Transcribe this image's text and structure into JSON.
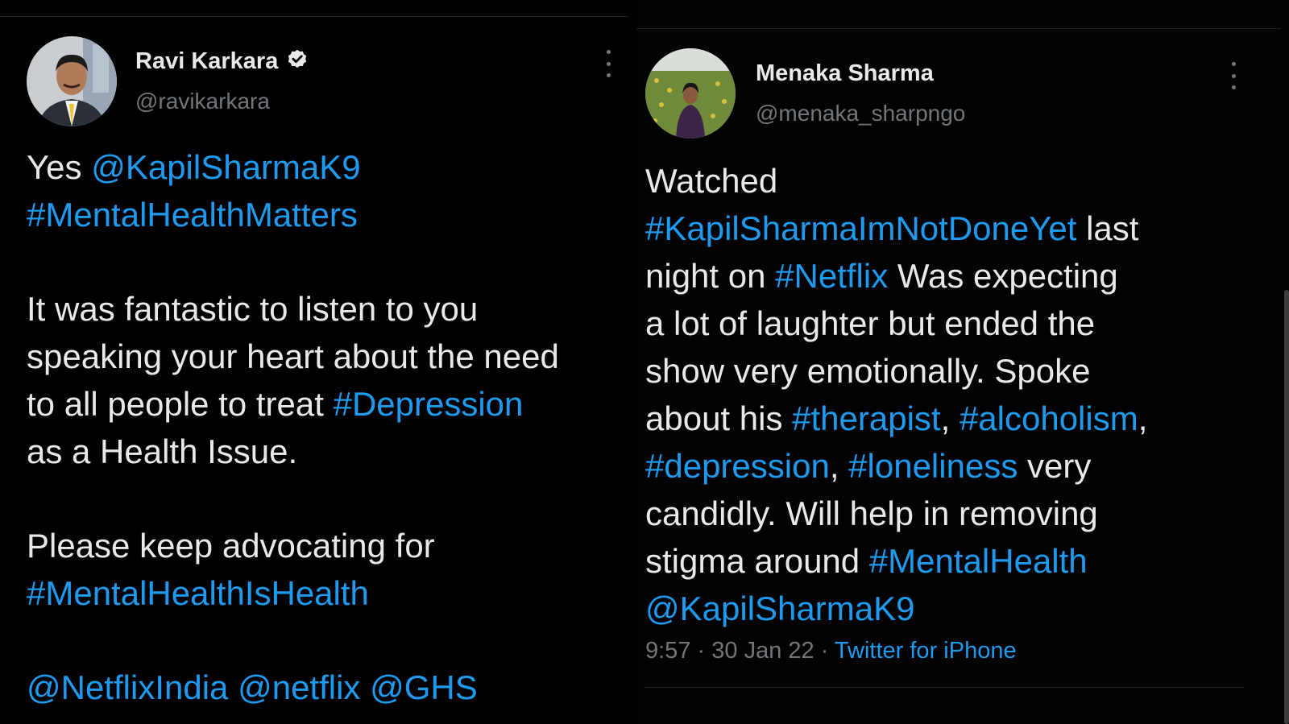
{
  "tweet_left": {
    "name": "Ravi Karkara",
    "verified": true,
    "handle": "@ravikarkara",
    "lines": [
      [
        {
          "t": "Yes "
        },
        {
          "t": "@KapilSharmaK9",
          "link": true
        }
      ],
      [
        {
          "t": "#MentalHealthMatters",
          "link": true
        }
      ],
      [],
      [
        {
          "t": "It was fantastic to listen to you"
        }
      ],
      [
        {
          "t": "speaking your heart about the need"
        }
      ],
      [
        {
          "t": "to all people to treat "
        },
        {
          "t": "#Depression",
          "link": true
        }
      ],
      [
        {
          "t": "as a Health Issue."
        }
      ],
      [],
      [
        {
          "t": "Please keep advocating for"
        }
      ],
      [
        {
          "t": "#MentalHealthIsHealth",
          "link": true
        }
      ],
      [],
      [
        {
          "t": "@NetflixIndia",
          "link": true
        },
        {
          "t": " "
        },
        {
          "t": "@netflix",
          "link": true
        },
        {
          "t": " "
        },
        {
          "t": "@GHS",
          "link": true
        }
      ]
    ]
  },
  "tweet_right": {
    "name": "Menaka Sharma",
    "verified": false,
    "handle": "@menaka_sharpngo",
    "lines": [
      [
        {
          "t": "Watched"
        }
      ],
      [
        {
          "t": "#KapilSharmaImNotDoneYet",
          "link": true
        },
        {
          "t": " last"
        }
      ],
      [
        {
          "t": "night on "
        },
        {
          "t": "#Netflix",
          "link": true
        },
        {
          "t": " Was expecting"
        }
      ],
      [
        {
          "t": "a lot of laughter but ended the"
        }
      ],
      [
        {
          "t": "show very emotionally. Spoke"
        }
      ],
      [
        {
          "t": "about his "
        },
        {
          "t": "#therapist",
          "link": true
        },
        {
          "t": ", "
        },
        {
          "t": "#alcoholism",
          "link": true
        },
        {
          "t": ","
        }
      ],
      [
        {
          "t": "#depression",
          "link": true
        },
        {
          "t": ", "
        },
        {
          "t": "#loneliness",
          "link": true
        },
        {
          "t": " very"
        }
      ],
      [
        {
          "t": "candidly. Will help in removing"
        }
      ],
      [
        {
          "t": "stigma around  "
        },
        {
          "t": "#MentalHealth",
          "link": true
        }
      ],
      [
        {
          "t": "@KapilSharmaK9",
          "link": true
        }
      ]
    ],
    "time": "9:57",
    "date": "30 Jan 22",
    "separator": "·",
    "source": "Twitter for iPhone"
  },
  "colors": {
    "background": "#000000",
    "text": "#e7e9ea",
    "muted": "#71767b",
    "link": "#1d9bf0"
  },
  "icons": {
    "verified": "verified-badge-icon",
    "more": "more-options-icon"
  }
}
